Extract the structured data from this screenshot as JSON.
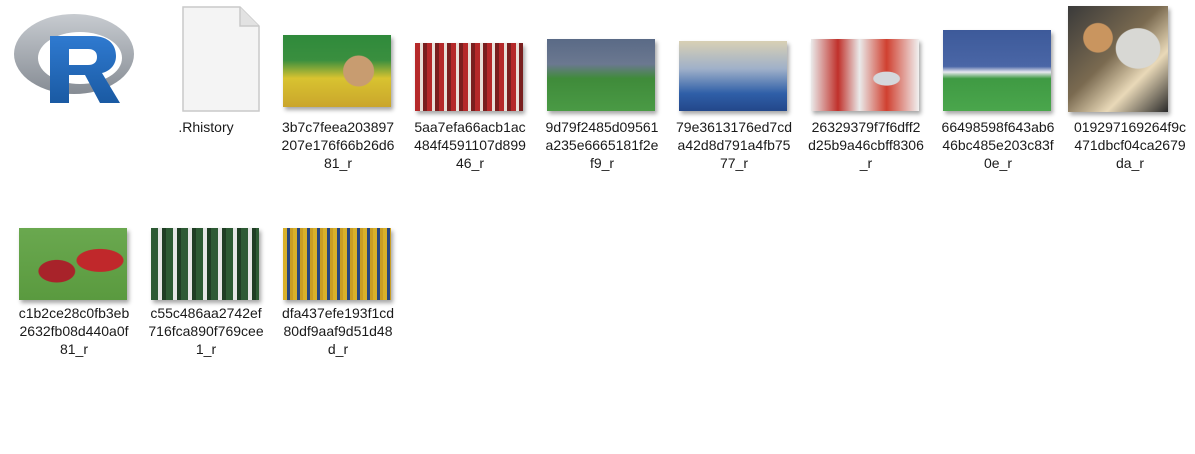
{
  "files": [
    {
      "name": "",
      "kind": "r-app-icon"
    },
    {
      "name": ".Rhistory",
      "kind": "document-icon"
    },
    {
      "name": "3b7c7feea203897207e176f66b26d681_r",
      "kind": "image"
    },
    {
      "name": "5aa7efa66acb1ac484f4591107d89946_r",
      "kind": "image"
    },
    {
      "name": "9d79f2485d09561a235e6665181f2ef9_r",
      "kind": "image"
    },
    {
      "name": "79e3613176ed7cda42d8d791a4fb7577_r",
      "kind": "image"
    },
    {
      "name": "26329379f7f6dff2d25b9a46cbff8306_r",
      "kind": "image"
    },
    {
      "name": "66498598f643ab646bc485e203c83f0e_r",
      "kind": "image"
    },
    {
      "name": "019297169264f9c471dbcf04ca2679da_r",
      "kind": "image"
    },
    {
      "name": "c1b2ce28c0fb3eb2632fb08d440a0f81_r",
      "kind": "image"
    },
    {
      "name": "c55c486aa2742ef716fca890f769cee1_r",
      "kind": "image"
    },
    {
      "name": "dfa437efe193f1cd80df9aaf9d51d48d_r",
      "kind": "image"
    }
  ],
  "colors": {
    "r_blue": "#2167b6",
    "r_gray": "#9aa0a8",
    "text": "#1a1a1a"
  }
}
